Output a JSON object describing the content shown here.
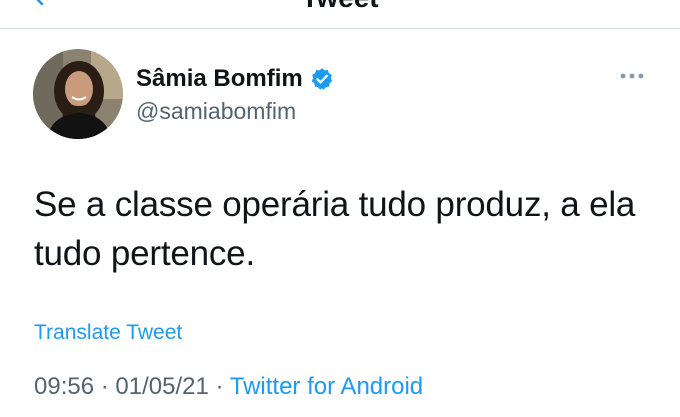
{
  "header": {
    "title": "Tweet",
    "back_icon": "chevron-left-icon"
  },
  "author": {
    "display_name": "Sâmia Bomfim",
    "handle": "@samiabomfim",
    "verified_icon": "verified-badge-icon",
    "more_icon": "more-horizontal-icon"
  },
  "tweet": {
    "text": "Se a classe operária tudo produz, a ela tudo pertence.",
    "translate_label": "Translate Tweet",
    "time": "09:56",
    "separator": "·",
    "date": "01/05/21",
    "source": "Twitter for Android"
  },
  "colors": {
    "accent": "#1d9bf0",
    "text_primary": "#0f1419",
    "text_secondary": "#536471",
    "divider": "#d6dbdf"
  }
}
